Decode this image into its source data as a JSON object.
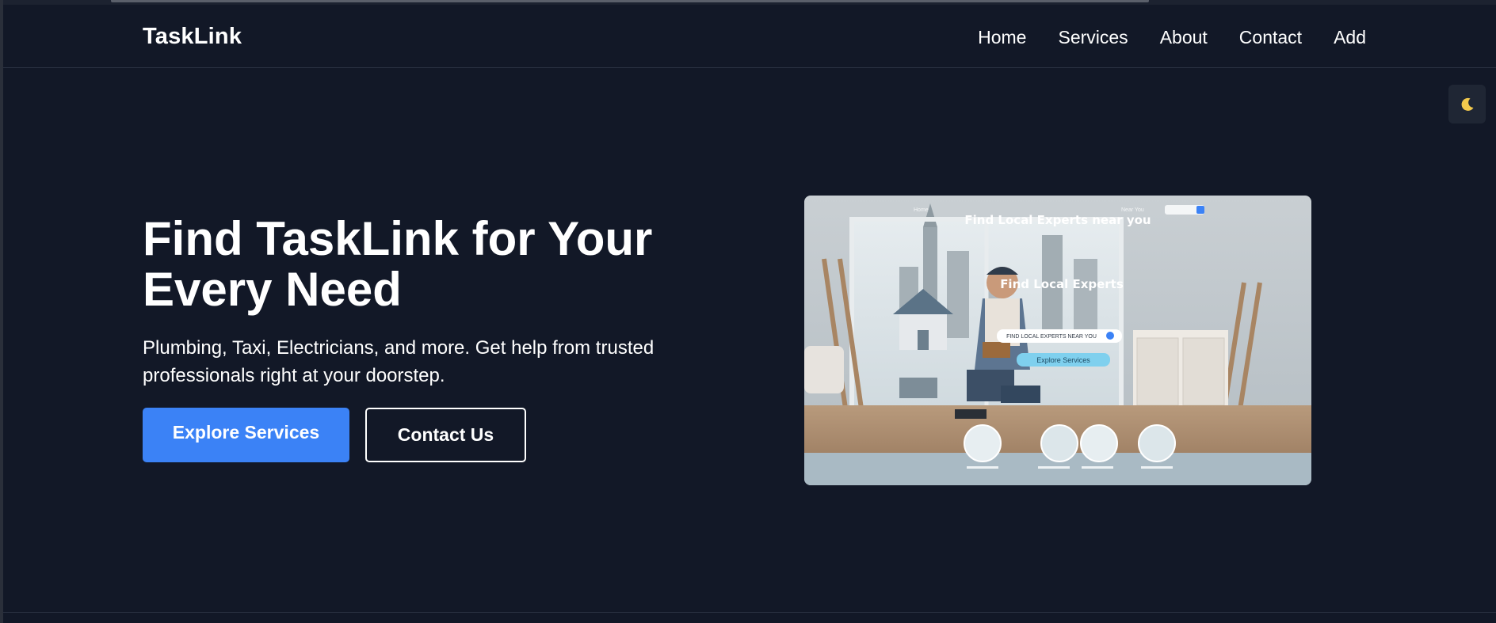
{
  "brand": "TaskLink",
  "nav": [
    {
      "label": "Home"
    },
    {
      "label": "Services"
    },
    {
      "label": "About"
    },
    {
      "label": "Contact"
    },
    {
      "label": "Add"
    }
  ],
  "theme_toggle": {
    "icon": "moon-icon"
  },
  "hero": {
    "title_line1": "Find TaskLink for Your",
    "title_line2": "Every Need",
    "subtitle_line1": "Plumbing, Taxi, Electricians, and more. Get help from trusted",
    "subtitle_line2": "professionals right at your doorstep.",
    "primary_button": "Explore Services",
    "secondary_button": "Contact Us"
  },
  "hero_image": {
    "heading": "Find Local Experts near you",
    "subheading": "Find Local Experts",
    "search_text": "FIND LOCAL EXPERTS NEAR YOU",
    "button_text": "Explore Services",
    "nav_left": "Home",
    "nav_right": "Near You"
  },
  "colors": {
    "background": "#121827",
    "accent": "#3b82f6"
  }
}
